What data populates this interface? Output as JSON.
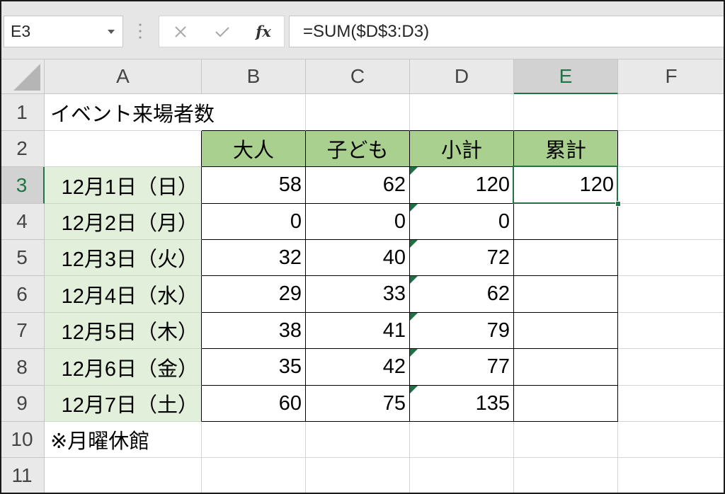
{
  "formula_bar": {
    "name_box": "E3",
    "name_box_dropdown_icon": "chevron-down-icon",
    "options_icon": "vertical-dots-icon",
    "cancel_icon": "close-icon",
    "enter_icon": "check-icon",
    "function_label": "fx",
    "formula": "=SUM($D$3:D3)"
  },
  "columns": [
    "A",
    "B",
    "C",
    "D",
    "E",
    "F"
  ],
  "rows": [
    "1",
    "2",
    "3",
    "4",
    "5",
    "6",
    "7",
    "8",
    "9",
    "10",
    "11"
  ],
  "sheet": {
    "title": "イベント来場者数",
    "headers": [
      "大人",
      "子ども",
      "小計",
      "累計"
    ],
    "records": [
      {
        "date": "12月1日（日）",
        "adults": 58,
        "children": 62,
        "subtotal": 120,
        "cumulative": 120
      },
      {
        "date": "12月2日（月）",
        "adults": 0,
        "children": 0,
        "subtotal": 0
      },
      {
        "date": "12月3日（火）",
        "adults": 32,
        "children": 40,
        "subtotal": 72
      },
      {
        "date": "12月4日（水）",
        "adults": 29,
        "children": 33,
        "subtotal": 62
      },
      {
        "date": "12月5日（木）",
        "adults": 38,
        "children": 41,
        "subtotal": 79
      },
      {
        "date": "12月6日（金）",
        "adults": 35,
        "children": 42,
        "subtotal": 77
      },
      {
        "date": "12月7日（土）",
        "adults": 60,
        "children": 75,
        "subtotal": 135
      }
    ],
    "note": "※月曜休館"
  },
  "colors": {
    "accent": "#217346",
    "header_fill": "#a9d08e",
    "date_fill": "#e2efda",
    "error_indicator": "#1e7145"
  }
}
